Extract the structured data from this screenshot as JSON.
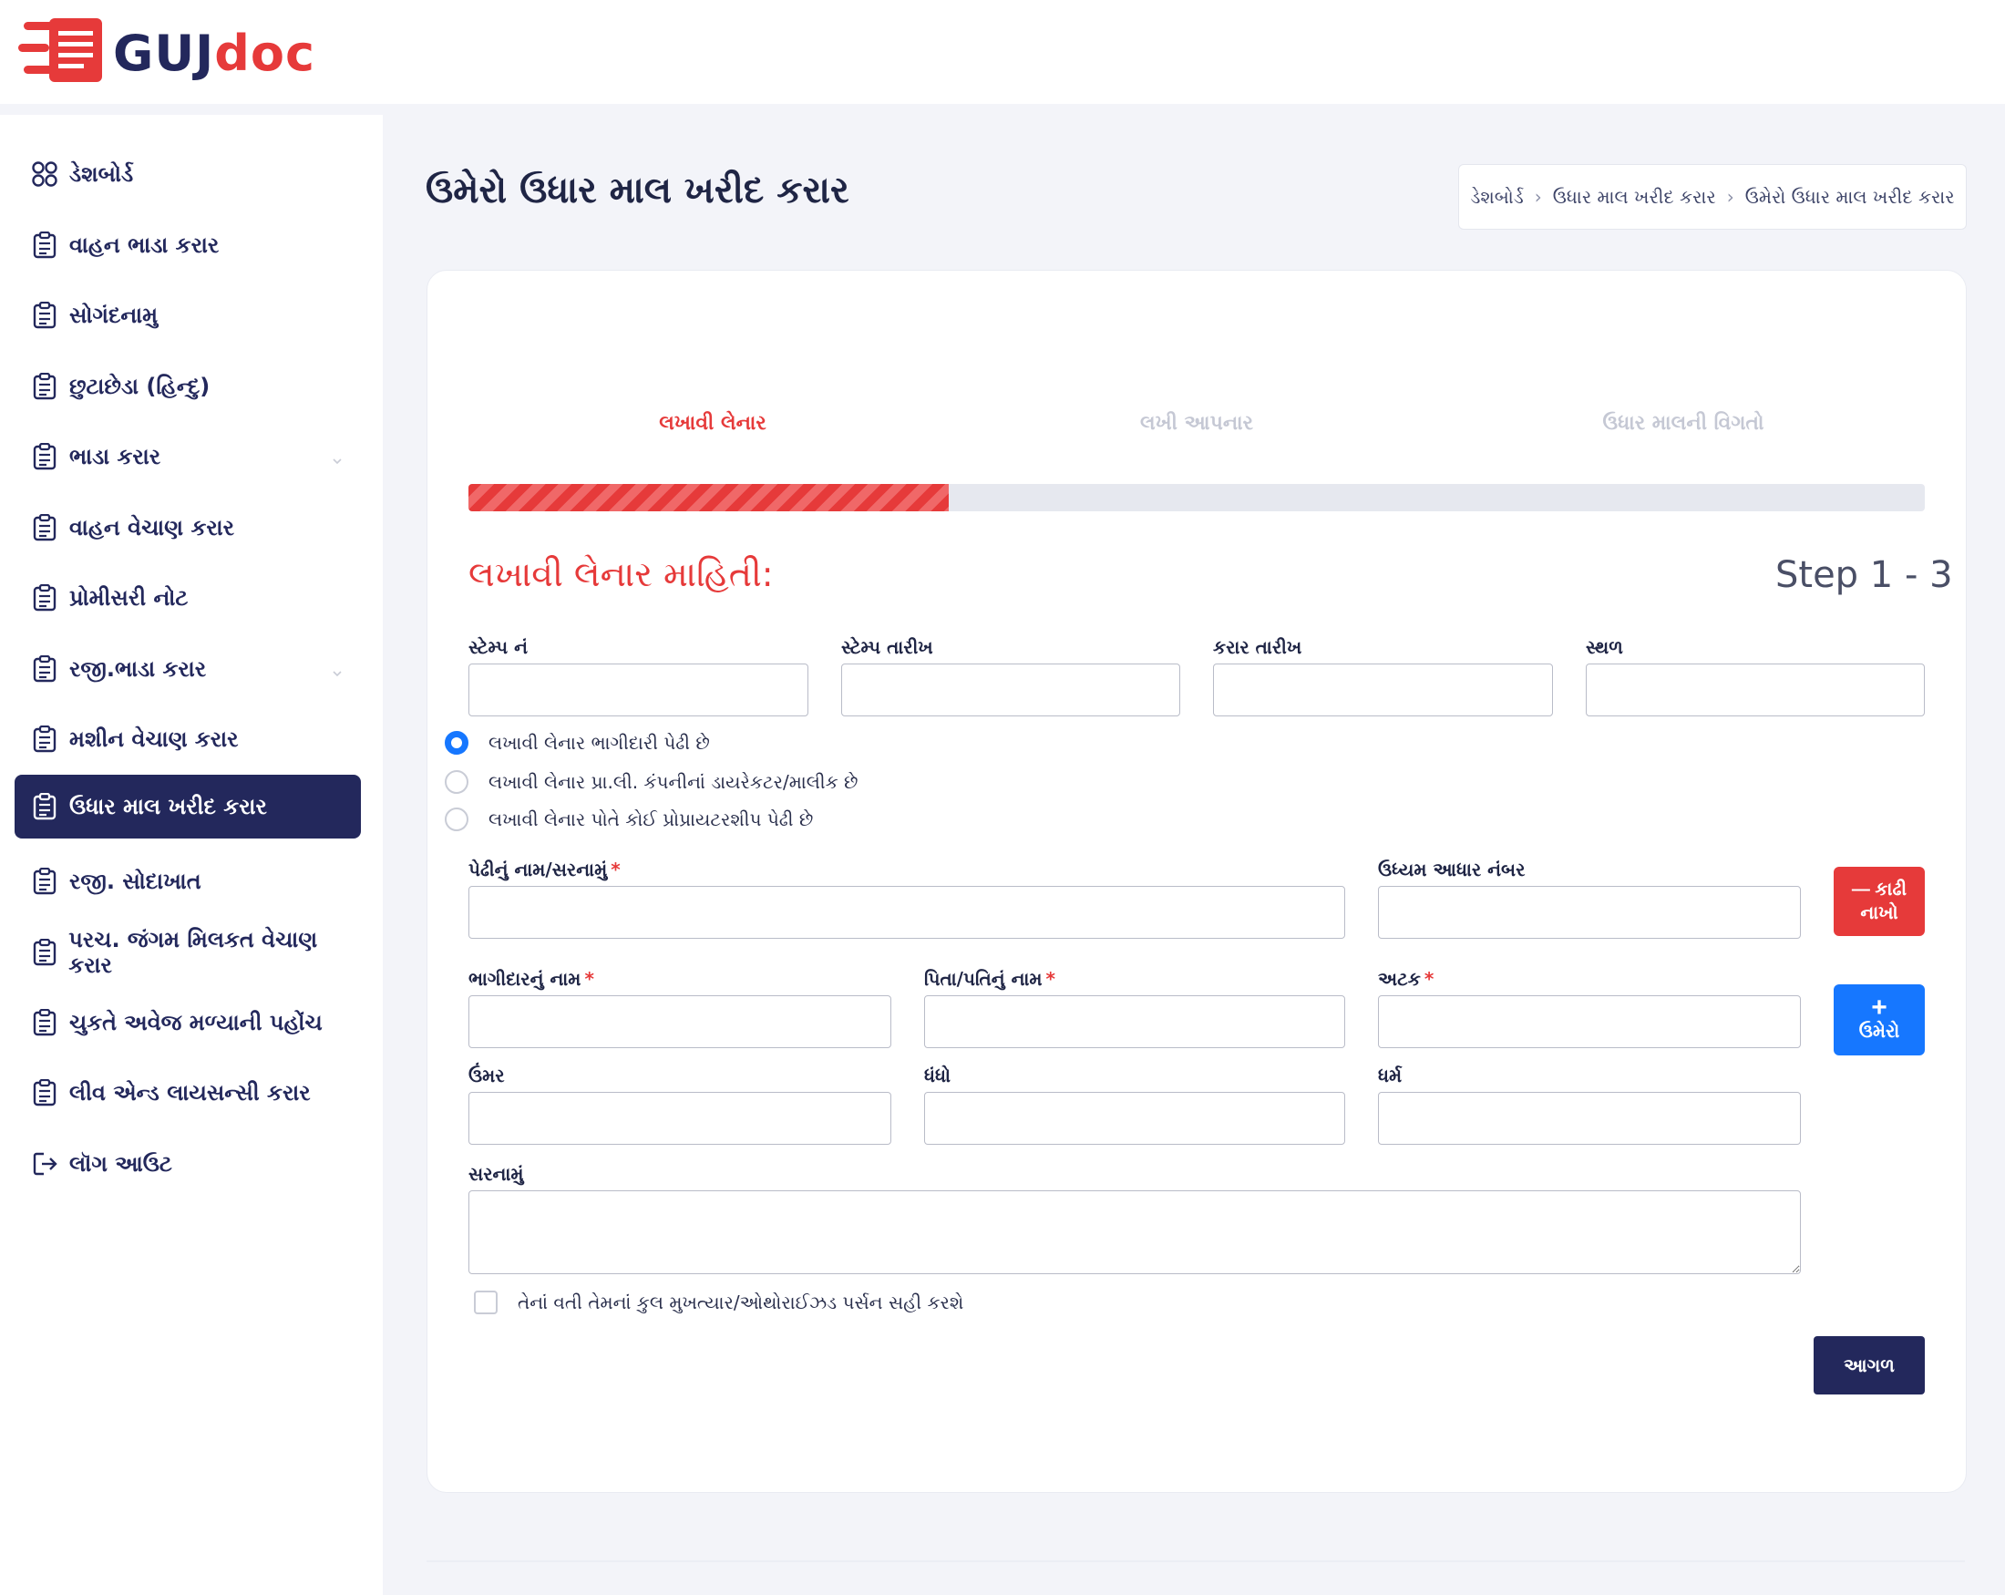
{
  "brand": {
    "name_part1": "GUJ",
    "name_part2": "doc"
  },
  "sidebar": {
    "items": [
      {
        "label": "ડેશબોર્ડ",
        "icon": "grid-icon"
      },
      {
        "label": "વાહન ભાડા કરાર",
        "icon": "clipboard-icon"
      },
      {
        "label": "સોગંદનામુ",
        "icon": "clipboard-icon"
      },
      {
        "label": "છુટાછેડા (હિન્દુ)",
        "icon": "clipboard-icon"
      },
      {
        "label": "ભાડા કરાર",
        "icon": "clipboard-icon",
        "has_submenu": true
      },
      {
        "label": "વાહન વેચાણ કરાર",
        "icon": "clipboard-icon"
      },
      {
        "label": "પ્રોમીસરી નોટ",
        "icon": "clipboard-icon"
      },
      {
        "label": "રજી.ભાડા કરાર",
        "icon": "clipboard-icon",
        "has_submenu": true
      },
      {
        "label": "મશીન વેચાણ કરાર",
        "icon": "clipboard-icon"
      },
      {
        "label": "ઉધાર માલ ખરીદ કરાર",
        "icon": "clipboard-icon",
        "active": true
      },
      {
        "label": "રજી. સોદાખાત",
        "icon": "clipboard-icon"
      },
      {
        "label": "પરચ. જંગમ મિલકત વેચાણ કરાર",
        "icon": "clipboard-icon"
      },
      {
        "label": "ચુકતે અવેજ મળ્યાની પહોંચ",
        "icon": "clipboard-icon"
      },
      {
        "label": "લીવ એન્ડ લાયસન્સી કરાર",
        "icon": "clipboard-icon"
      },
      {
        "label": "લૉગ આઉટ",
        "icon": "logout-icon"
      }
    ]
  },
  "page": {
    "title": "ઉમેરો ઉધાર માલ ખરીદ કરાર",
    "breadcrumb": [
      "ડેશબોર્ડ",
      "ઉધાર માલ ખરીદ કરાર",
      "ઉમેરો ઉધાર માલ ખરીદ કરાર"
    ]
  },
  "wizard": {
    "steps": [
      "લખાવી લેનાર",
      "લખી આપનાર",
      "ઉધાર માલની વિગતો"
    ],
    "active_step": 0,
    "progress": 0.33,
    "section_heading": "લખાવી લેનાર માહિતી:",
    "step_counter": "Step 1 - 3"
  },
  "form": {
    "stamp_no_label": "સ્ટેમ્પ નં",
    "stamp_date_label": "સ્ટેમ્પ તારીખ",
    "agreement_date_label": "કરાર તારીખ",
    "place_label": "સ્થળ",
    "radio_options": [
      "લખાવી લેનાર ભાગીદારી પેઢી છે",
      "લખાવી લેનાર પ્રા.લી. કંપનીનાં ડાયરેકટર/માલીક છે",
      "લખાવી લેનાર પોતે કોઈ પ્રોપ્રાયટરશીપ પેઢી છે"
    ],
    "selected_radio": 0,
    "firm_label": "પેઢીનું નામ/સરનામું",
    "udyam_label": "ઉધ્યમ આધાર નંબર",
    "partner_name_label": "ભાગીદારનું નામ",
    "father_name_label": "પિતા/પતિનું નામ",
    "surname_label": "અટક",
    "age_label": "ઉંમર",
    "occupation_label": "ધંધો",
    "religion_label": "ધર્મ",
    "address_label": "સરનામું",
    "required_mark": "*",
    "remove_button": {
      "line1": "— કાઢી",
      "line2": "નાખો"
    },
    "add_button": {
      "line1": "+",
      "line2": "ઉમેરો"
    },
    "checkbox_label": "તેનાં વતી તેમનાં કુલ મુખત્યાર/ઓથોરાઈઝડ પર્સન સહી કરશે",
    "next_button": "આગળ"
  },
  "colors": {
    "brand_navy": "#23285c",
    "brand_red": "#e63a3a",
    "accent_blue": "#1677ff"
  }
}
